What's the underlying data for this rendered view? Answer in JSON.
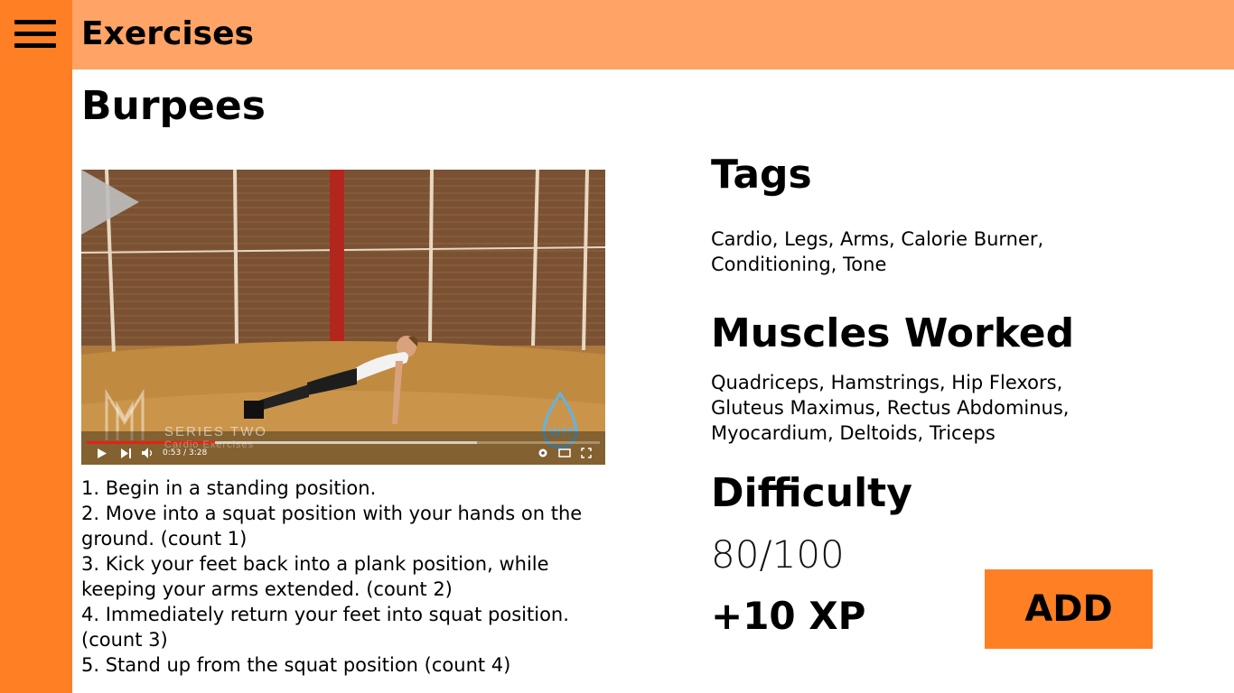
{
  "header": {
    "menu_icon": "hamburger-menu-icon",
    "title": "Exercises"
  },
  "exercise": {
    "name": "Burpees",
    "video": {
      "series_text": "SERIES TWO",
      "subtitle_text": "Cardio Exercises",
      "time": "0:53 / 3:28",
      "progress": 0.25,
      "buffered": 0.76
    },
    "steps": [
      "1. Begin in a standing position.",
      "2. Move into a squat position with your hands on the ground. (count 1)",
      "3. Kick your feet back into a plank position, while keeping your arms extended. (count 2)",
      "4. Immediately return your feet into squat position. (count 3)",
      "5. Stand up from the squat position (count 4)"
    ]
  },
  "details": {
    "tags_heading": "Tags",
    "tags_text": "Cardio, Legs, Arms, Calorie Burner, Conditioning, Tone",
    "muscles_heading": "Muscles Worked",
    "muscles_text": "Quadriceps, Hamstrings, Hip Flexors, Gluteus Maximus, Rectus Abdominus, Myocardium, Deltoids, Triceps",
    "difficulty_heading": "Difficulty",
    "difficulty_value": "80/100",
    "xp": "+10 XP",
    "add_label": "ADD"
  },
  "colors": {
    "sidebar": "#ff7f24",
    "topbar": "#ffa366",
    "add_button": "#ff7f24"
  }
}
